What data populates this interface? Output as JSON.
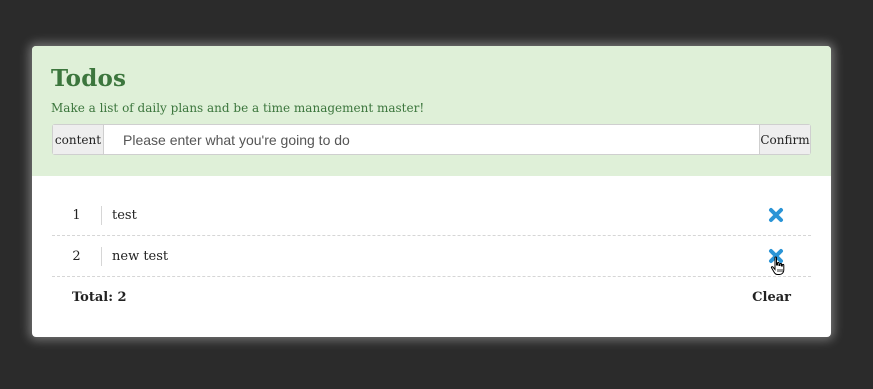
{
  "header": {
    "title": "Todos",
    "subtitle": "Make a list of daily plans and be a time management master!"
  },
  "form": {
    "label": "content",
    "placeholder": "Please enter what you're going to do",
    "value": "",
    "confirm_label": "Confirm"
  },
  "todos": [
    {
      "index": "1",
      "text": "test"
    },
    {
      "index": "2",
      "text": "new test"
    }
  ],
  "footer": {
    "total": "Total: 2",
    "clear_label": "Clear"
  },
  "colors": {
    "header_bg": "#dff0d8",
    "title": "#3c763d",
    "delete_icon": "#2a94d6",
    "page_bg": "#2b2b2b"
  },
  "icons": {
    "delete": "close-icon",
    "cursor": "hand-pointer-icon"
  }
}
